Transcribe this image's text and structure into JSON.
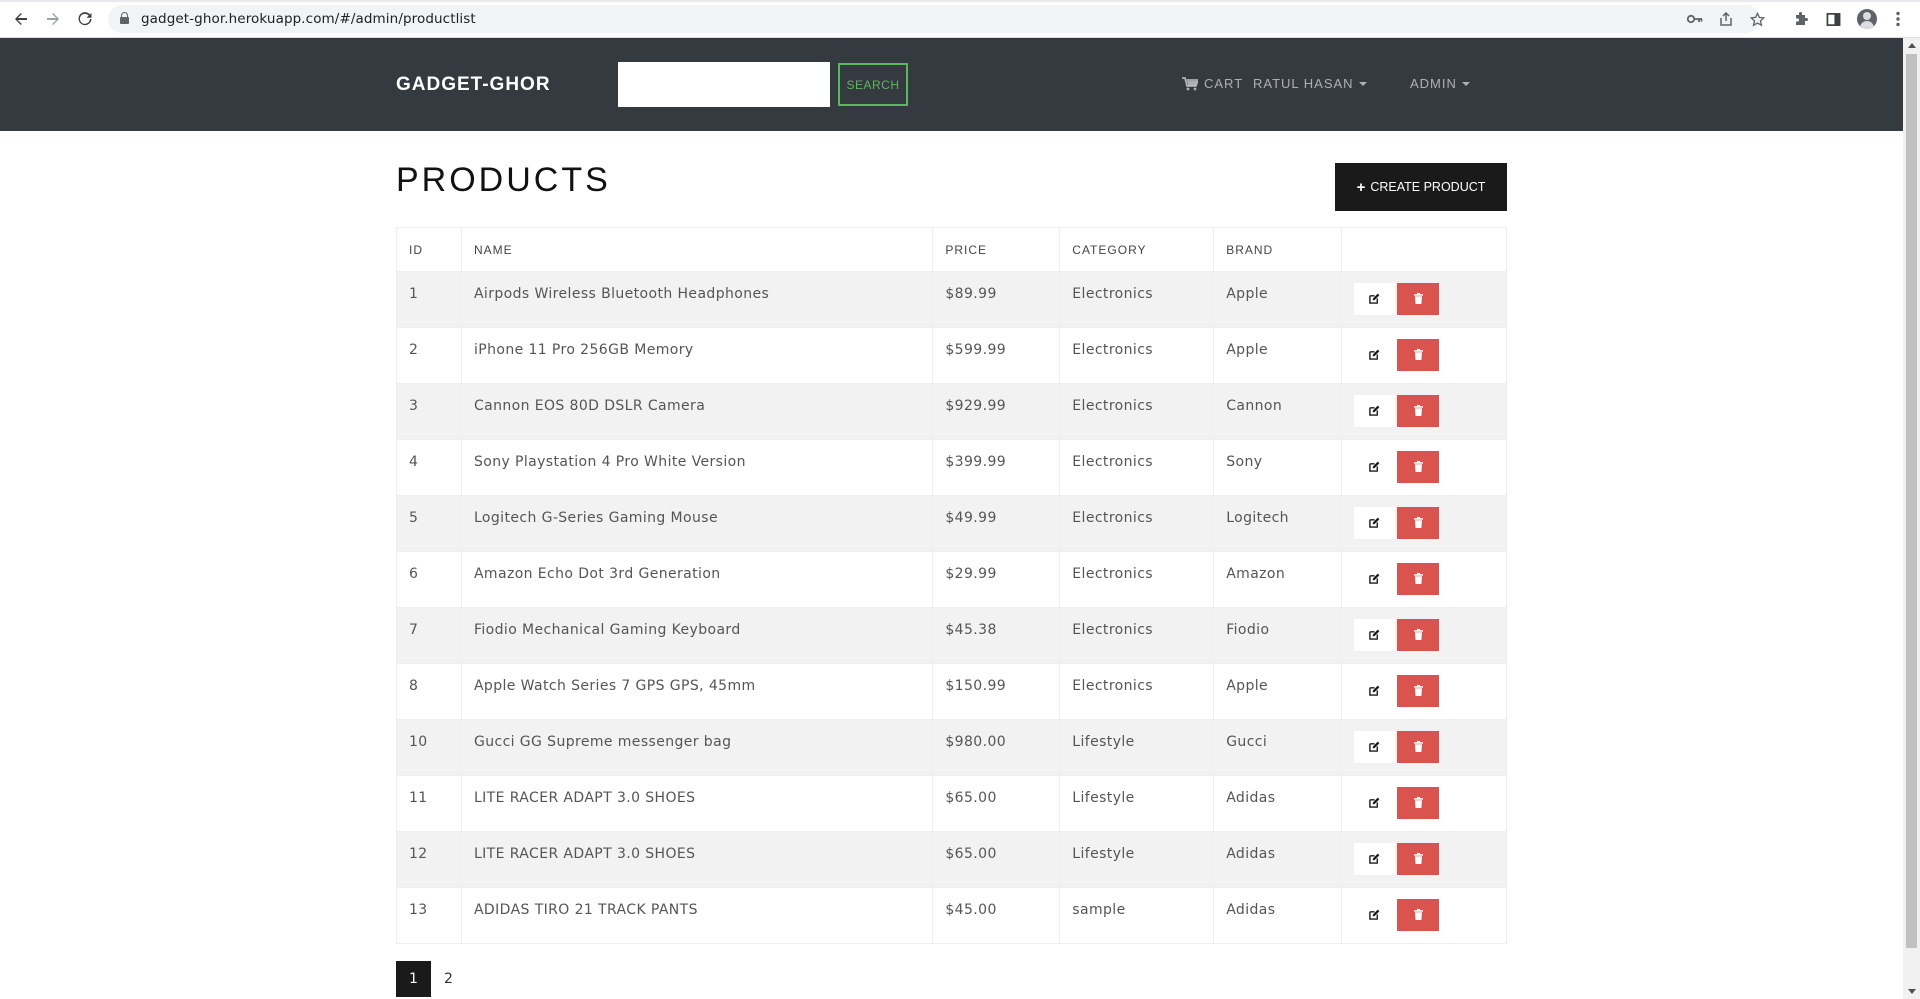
{
  "browser": {
    "url": "gadget-ghor.herokuapp.com/#/admin/productlist"
  },
  "navbar": {
    "brand": "GADGET-GHOR",
    "search_placeholder": "",
    "search_label": "SEARCH",
    "cart_label": "CART",
    "user_label": "RATUL HASAN",
    "admin_label": "ADMIN"
  },
  "page": {
    "title": "PRODUCTS",
    "create_label": "CREATE PRODUCT"
  },
  "table": {
    "headers": [
      "ID",
      "NAME",
      "PRICE",
      "CATEGORY",
      "BRAND",
      ""
    ],
    "rows": [
      {
        "id": "1",
        "name": "Airpods Wireless Bluetooth Headphones",
        "price": "$89.99",
        "category": "Electronics",
        "brand": "Apple"
      },
      {
        "id": "2",
        "name": "iPhone 11 Pro 256GB Memory",
        "price": "$599.99",
        "category": "Electronics",
        "brand": "Apple"
      },
      {
        "id": "3",
        "name": "Cannon EOS 80D DSLR Camera",
        "price": "$929.99",
        "category": "Electronics",
        "brand": "Cannon"
      },
      {
        "id": "4",
        "name": "Sony Playstation 4 Pro White Version",
        "price": "$399.99",
        "category": "Electronics",
        "brand": "Sony"
      },
      {
        "id": "5",
        "name": "Logitech G-Series Gaming Mouse",
        "price": "$49.99",
        "category": "Electronics",
        "brand": "Logitech"
      },
      {
        "id": "6",
        "name": "Amazon Echo Dot 3rd Generation",
        "price": "$29.99",
        "category": "Electronics",
        "brand": "Amazon"
      },
      {
        "id": "7",
        "name": "Fiodio Mechanical Gaming Keyboard",
        "price": "$45.38",
        "category": "Electronics",
        "brand": "Fiodio"
      },
      {
        "id": "8",
        "name": "Apple Watch Series 7 GPS GPS, 45mm",
        "price": "$150.99",
        "category": "Electronics",
        "brand": "Apple"
      },
      {
        "id": "10",
        "name": "Gucci GG Supreme messenger bag",
        "price": "$980.00",
        "category": "Lifestyle",
        "brand": "Gucci"
      },
      {
        "id": "11",
        "name": "LITE RACER ADAPT 3.0 SHOES",
        "price": "$65.00",
        "category": "Lifestyle",
        "brand": "Adidas"
      },
      {
        "id": "12",
        "name": "LITE RACER ADAPT 3.0 SHOES",
        "price": "$65.00",
        "category": "Lifestyle",
        "brand": "Adidas"
      },
      {
        "id": "13",
        "name": "ADIDAS TIRO 21 TRACK PANTS",
        "price": "$45.00",
        "category": "sample",
        "brand": "Adidas"
      }
    ],
    "edit_icon": "edit-icon",
    "delete_icon": "trash-icon"
  },
  "pagination": {
    "pages": [
      "1",
      "2"
    ],
    "active": "1"
  },
  "colors": {
    "navbar_bg": "#343a40",
    "search_accent": "#5cb85c",
    "delete_red": "#d9534f",
    "dark_button": "#1a1a1a",
    "stripe": "#f2f2f2"
  }
}
